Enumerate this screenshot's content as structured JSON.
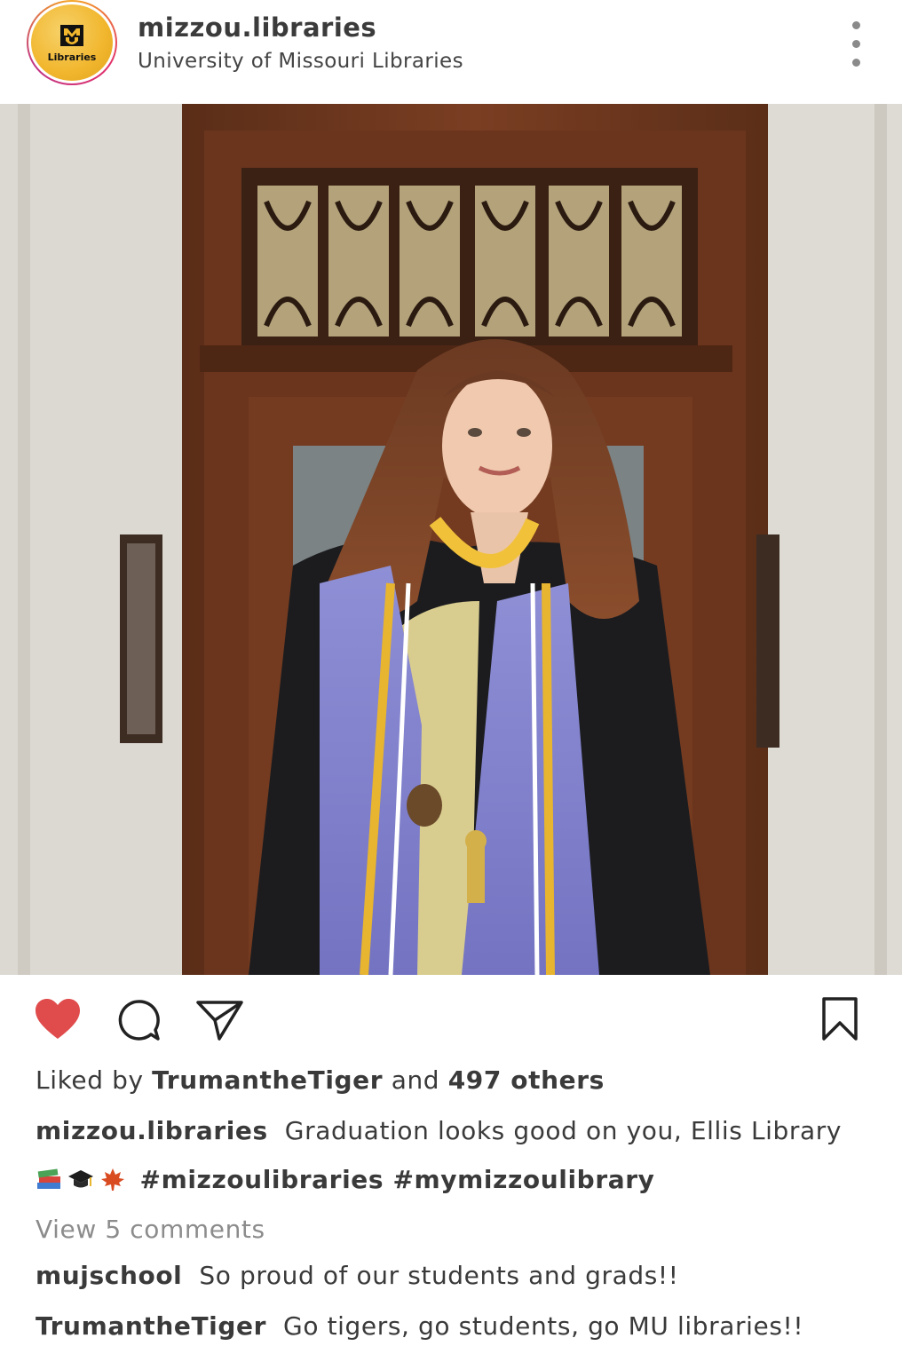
{
  "header": {
    "username": "mizzou.libraries",
    "subtitle": "University of Missouri Libraries",
    "avatar_label": "Libraries",
    "avatar_logo": "MU"
  },
  "post": {
    "image_alt": "Graduate in black gown with lavender stole and gold cords standing in front of a wooden library door"
  },
  "actions": {
    "like_icon": "heart-filled-icon",
    "comment_icon": "comment-bubble-icon",
    "share_icon": "paper-plane-icon",
    "save_icon": "bookmark-icon",
    "like_color": "#e04b4b"
  },
  "likes": {
    "prefix": "Liked by",
    "user": "TrumantheTiger",
    "joiner": "and",
    "others": "497 others"
  },
  "caption": {
    "user": "mizzou.libraries",
    "text": "Graduation looks good on you, Ellis Library",
    "emojis": [
      "books-emoji",
      "graduation-cap-emoji",
      "maple-leaf-emoji"
    ],
    "hashtags": "#mizzoulibraries #mymizzoulibrary"
  },
  "view_comments": "View 5 comments",
  "comments": [
    {
      "user": "mujschool",
      "text": "So proud of our students and grads!!"
    },
    {
      "user": "TrumantheTiger",
      "text": "Go tigers, go students, go MU libraries!!"
    }
  ]
}
